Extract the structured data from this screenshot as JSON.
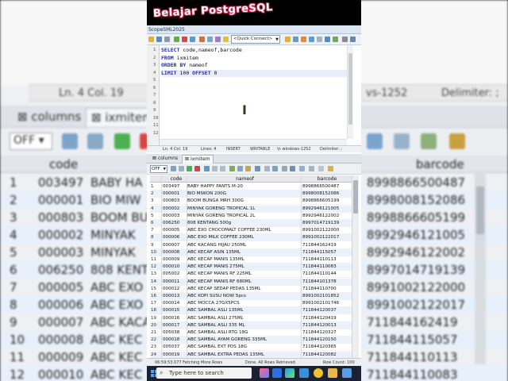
{
  "banner": {
    "title": "Belajar PostgreSQL"
  },
  "window": {
    "title": "ScopeSML2025"
  },
  "toolbar": {
    "quick_connect": "<Quick Connect>"
  },
  "editor": {
    "lines": [
      [
        {
          "t": "SELECT",
          "k": true
        },
        {
          "t": " code,nameof,barcode",
          "k": false
        }
      ],
      [
        {
          "t": "FROM",
          "k": true
        },
        {
          "t": " ixmitem",
          "k": false
        }
      ],
      [
        {
          "t": "ORDER BY",
          "k": true
        },
        {
          "t": " nameof",
          "k": false
        }
      ],
      [
        {
          "t": "LIMIT",
          "k": true
        },
        {
          "t": " 100 ",
          "k": false
        },
        {
          "t": "OFFSET",
          "k": true
        },
        {
          "t": " 0",
          "k": false
        }
      ],
      [],
      [],
      [],
      [],
      [],
      [],
      [],
      []
    ],
    "line_numbers": [
      "1",
      "2",
      "3",
      "4",
      "5",
      "6",
      "7",
      "8",
      "9",
      "10",
      "11",
      "12"
    ]
  },
  "status": {
    "position": "Ln. 4 Col. 19",
    "lines": "Lines: 4",
    "mode": "INSERT",
    "writable": "WRITABLE",
    "encoding": "\\n  windows-1252",
    "delimiter": "Delimiter: ;"
  },
  "background": {
    "status_position": "Ln. 4 Col. 19",
    "status_encoding": "vs-1252",
    "status_delimiter": "Delimiter: ;",
    "tab_columns": "columns",
    "tab_ixmitem": "ixmiten",
    "off_label": "OFF",
    "col_code": "code",
    "col_barcode": "barcode",
    "rows": [
      {
        "i": "1",
        "code": "003497",
        "name": "BABY HA",
        "bar": "8998866500487"
      },
      {
        "i": "2",
        "code": "000001",
        "name": "BIO MIW",
        "bar": "8998008152086"
      },
      {
        "i": "3",
        "code": "000803",
        "name": "BOOM BU",
        "bar": "8998866605199"
      },
      {
        "i": "4",
        "code": "000002",
        "name": "MINYAK",
        "bar": "8992946121005"
      },
      {
        "i": "5",
        "code": "000003",
        "name": "MINYAK",
        "bar": "8992946122002"
      },
      {
        "i": "6",
        "code": "006250",
        "name": "808 KENT",
        "bar": "8997014719139"
      },
      {
        "i": "7",
        "code": "000005",
        "name": "ABC EXO",
        "bar": "8991002122000"
      },
      {
        "i": "8",
        "code": "000006",
        "name": "ABC EXO",
        "bar": "8991002122017"
      },
      {
        "i": "9",
        "code": "000007",
        "name": "ABC KACA",
        "bar": "711844162419"
      },
      {
        "i": "10",
        "code": "000008",
        "name": "ABC KEC",
        "bar": "711844115057"
      },
      {
        "i": "11",
        "code": "000009",
        "name": "ABC KEC",
        "bar": "711844110113"
      },
      {
        "i": "12",
        "code": "000010",
        "name": "ABC KEC",
        "bar": "711844110083"
      }
    ]
  },
  "results": {
    "tab_columns": "columns",
    "tab_ixmitem": "ixmitem",
    "off_label": "OFF",
    "headers": {
      "code": "code",
      "nameof": "nameof",
      "barcode": "barcode"
    },
    "rows": [
      [
        "1",
        "003497",
        "BABY HAPPY PANTS M-20",
        "8998866500487"
      ],
      [
        "2",
        "000001",
        "BIO MIWON 200G",
        "8998008152086"
      ],
      [
        "3",
        "000803",
        "BOOM BUNGA MRH 300G",
        "8998866605199"
      ],
      [
        "4",
        "000002",
        "MINYAK GORENG TROPICAL 1L",
        "8992946121005"
      ],
      [
        "5",
        "000003",
        "MINYAK GORENG TROPICAL 2L",
        "8992946122002"
      ],
      [
        "6",
        "006250",
        "808 KENTANG 500g",
        "8997014719139"
      ],
      [
        "7",
        "000005",
        "ABC EXO CHOCOMALT COFFEE 230ML",
        "8991002122000"
      ],
      [
        "8",
        "000006",
        "ABC EXO MILK COFFEE 230ML",
        "8991002122017"
      ],
      [
        "9",
        "000007",
        "ABC KACANG HIJAU 250ML",
        "711844162419"
      ],
      [
        "10",
        "000008",
        "ABC KECAP ASIN 135ML",
        "711844115057"
      ],
      [
        "11",
        "000009",
        "ABC KECAP MANIS 135ML",
        "711844110113"
      ],
      [
        "12",
        "000010",
        "ABC KECAP MANIS 275ML",
        "711844110083"
      ],
      [
        "13",
        "005002",
        "ABC KECAP MANIS RF 225ML",
        "711844110144"
      ],
      [
        "14",
        "000011",
        "ABC KECAP MANIS RF 680ML",
        "711844101378"
      ],
      [
        "15",
        "000012",
        "ABC KECAP SEDAP PEDAS 135ML",
        "711844110700"
      ],
      [
        "16",
        "000013",
        "ABC KOPI SUSU NOW 5pcs",
        "8991002101852"
      ],
      [
        "17",
        "000014",
        "ABC MOCCA 27GX5PCS",
        "8991002101746"
      ],
      [
        "18",
        "000015",
        "ABC SAMBAL ASLI 135ML",
        "711844120037"
      ],
      [
        "19",
        "000016",
        "ABC SAMBAL ASLI 275ML",
        "711844120419"
      ],
      [
        "20",
        "000017",
        "ABC SAMBAL ASLI 335 ML",
        "711844120013"
      ],
      [
        "21",
        "005038",
        "ABC SAMBAL ASLI RTG 18G",
        "711844120327"
      ],
      [
        "22",
        "000018",
        "ABC SAMBAL AYAM GORENG 335ML",
        "711844120150"
      ],
      [
        "23",
        "005037",
        "ABC SAMBAL EXT PDS 18G",
        "711844120365"
      ],
      [
        "24",
        "000019",
        "ABC SAMBAL EXTRA PEDAS 135ML",
        "711844120082"
      ]
    ],
    "status": {
      "time": "06:59:53.077 Fetching More Rows",
      "done": "Done.  All Rows Retrieved.",
      "row_count": "Row Count: 100"
    }
  },
  "taskbar": {
    "search_placeholder": "Type here to search"
  },
  "colors": {
    "keyword": "#1a2acc",
    "banner_outline": "#c0244f",
    "alt_row": "#eaf1fb"
  }
}
